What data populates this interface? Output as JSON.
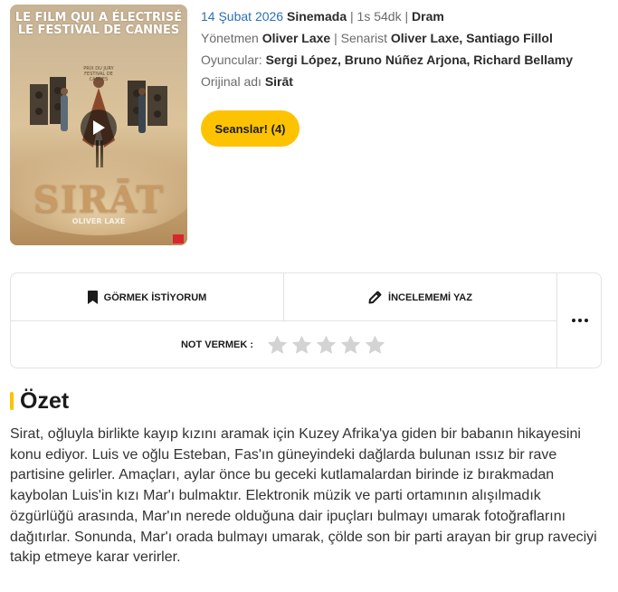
{
  "poster": {
    "tagline_line1": "LE FILM QUI A ÉLECTRISÉ",
    "tagline_line2": "LE FESTIVAL DE CANNES",
    "award": "PRIX DU JURY FESTIVAL DE CANNES",
    "title": "SIRĀT",
    "director_credit": "OLIVER LAXE",
    "play_icon": "play-icon"
  },
  "info": {
    "release_date": "14 Şubat 2026",
    "status": "Sinemada",
    "duration": "1s 54dk",
    "genre": "Dram",
    "director_label": "Yönetmen",
    "director": "Oliver Laxe",
    "writer_label": "Senarist",
    "writers": "Oliver Laxe, Santiago Fillol",
    "cast_label": "Oyuncular:",
    "cast": "Sergi López, Bruno Núñez Arjona, Richard Bellamy",
    "original_title_label": "Orijinal adı",
    "original_title": "Sirāt"
  },
  "showtimes_button": "Seanslar! (4)",
  "actions": {
    "watchlist_label": "GÖRMEK İSTİYORUM",
    "review_label": "İNCELEMEMİ YAZ",
    "rate_label": "NOT VERMEK :",
    "stars_count": 5,
    "stars_filled": 0,
    "icons": [
      "bookmark-icon",
      "pencil-icon",
      "more-icon",
      "star-icon"
    ]
  },
  "summary": {
    "heading": "Özet",
    "text": "Sirat, oğluyla birlikte kayıp kızını aramak için Kuzey Afrika'ya giden bir babanın hikayesini konu ediyor. Luis ve oğlu Esteban, Fas'ın güneyindeki dağlarda bulunan ıssız bir rave partisine gelirler. Amaçları, aylar önce bu geceki kutlamalardan birinde iz bırakmadan kaybolan Luis'in kızı Mar'ı bulmaktır. Elektronik müzik ve parti ortamının alışılmadık özgürlüğü arasında, Mar'ın nerede olduğuna dair ipuçları bulmayı umarak fotoğraflarını dağıtırlar. Sonunda, Mar'ı orada bulmayı umarak, çölde son bir parti arayan bir grup raveciyi takip etmeye karar verirler."
  },
  "colors": {
    "accent_yellow": "#fdc300",
    "date_blue": "#2c70b4",
    "star_gray": "#d3d3d3",
    "border": "#e3e3e3"
  }
}
